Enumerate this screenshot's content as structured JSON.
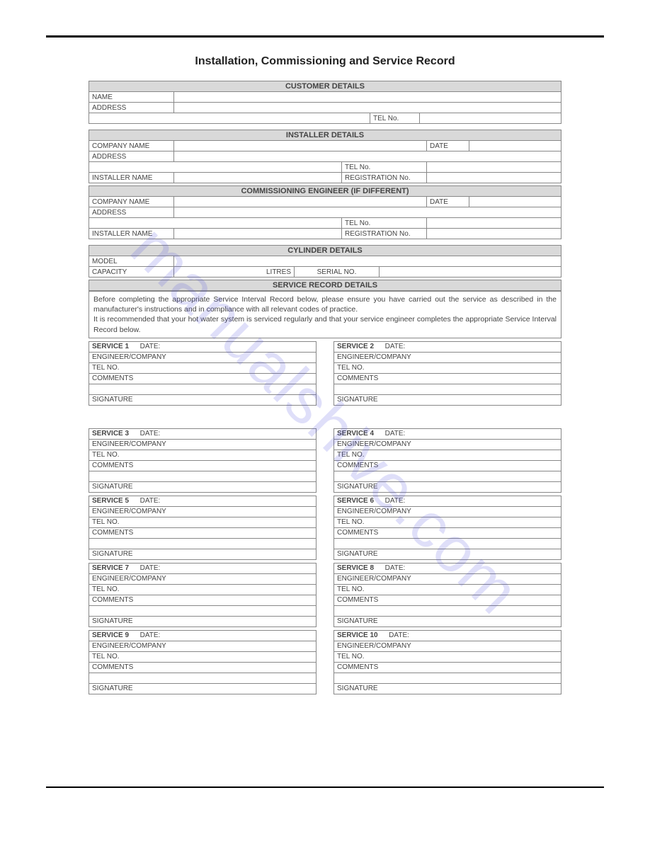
{
  "title": "Installation, Commissioning and Service Record",
  "watermark": "manualshive.com",
  "sections": {
    "customer": {
      "header": "CUSTOMER DETAILS",
      "name_label": "NAME",
      "address_label": "ADDRESS",
      "tel_label": "TEL No."
    },
    "installer": {
      "header": "INSTALLER DETAILS",
      "company_label": "COMPANY NAME",
      "date_label": "DATE",
      "address_label": "ADDRESS",
      "tel_label": "TEL No.",
      "installer_name_label": "INSTALLER NAME",
      "reg_label": "REGISTRATION No."
    },
    "commissioning": {
      "header": "COMMISSIONING ENGINEER (IF DIFFERENT)",
      "company_label": "COMPANY NAME",
      "date_label": "DATE",
      "address_label": "ADDRESS",
      "tel_label": "TEL No.",
      "installer_name_label": "INSTALLER NAME",
      "reg_label": "REGISTRATION No."
    },
    "cylinder": {
      "header": "CYLINDER DETAILS",
      "model_label": "MODEL",
      "capacity_label": "CAPACITY",
      "litres_label": "LITRES",
      "serial_label": "SERIAL NO."
    },
    "service_record": {
      "header": "SERVICE RECORD DETAILS",
      "para1": "Before completing the appropriate Service Interval Record below, please ensure you have carried out the service as described in the manufacturer's instructions and in compliance with all relevant codes of practice.",
      "para2": "It is recommended that your hot water system is serviced regularly and that your service engineer completes the appropriate Service Interval Record below."
    }
  },
  "service_block_labels": {
    "date": "DATE:",
    "engineer": "ENGINEER/COMPANY",
    "tel": "TEL NO.",
    "comments": "COMMENTS",
    "signature": "SIGNATURE"
  },
  "services": [
    {
      "num": "SERVICE 1"
    },
    {
      "num": "SERVICE 2"
    },
    {
      "num": "SERVICE 3"
    },
    {
      "num": "SERVICE 4"
    },
    {
      "num": "SERVICE 5"
    },
    {
      "num": "SERVICE 6"
    },
    {
      "num": "SERVICE 7"
    },
    {
      "num": "SERVICE 8"
    },
    {
      "num": "SERVICE 9"
    },
    {
      "num": "SERVICE 10"
    }
  ]
}
